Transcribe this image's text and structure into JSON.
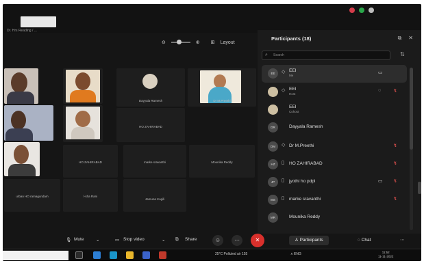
{
  "meeting": {
    "layout_label": "Layout",
    "top_strip_text": "Dr. Hrs Reading / ..."
  },
  "panel": {
    "title": "Participants (18)",
    "search_placeholder": "Search",
    "participants": [
      {
        "initials": "EE",
        "name": "EEI",
        "sub": "Me",
        "selected": true
      },
      {
        "initials": "",
        "name": "EEI",
        "sub": "Host",
        "selected": false
      },
      {
        "initials": "",
        "name": "EEI",
        "sub": "Cohost",
        "selected": false
      },
      {
        "initials": "DR",
        "name": "Dayyala Ramesh",
        "sub": "",
        "selected": false
      },
      {
        "initials": "DM",
        "name": "Dr M.Preethi",
        "sub": "",
        "selected": false
      },
      {
        "initials": "HZ",
        "name": "HO ZAHIRABAD",
        "sub": "",
        "selected": false
      },
      {
        "initials": "JP",
        "name": "jyothi ho pdpl",
        "sub": "",
        "selected": false
      },
      {
        "initials": "MS",
        "name": "marke sravanthi",
        "sub": "",
        "selected": false
      },
      {
        "initials": "MR",
        "name": "Mounika Reddy",
        "sub": "",
        "selected": false
      }
    ]
  },
  "tiles": {
    "dayyala": "Dayyala Ramesh",
    "preethi": "Dr M.Preethi",
    "zahirabad": "HO ZAHIRABAD",
    "marke": "marke sravanthi",
    "mounika": "Mounika Reddy",
    "ramagundam": "urban HO ramagundam",
    "lucky": "l-sha Rani",
    "jamuna": "Jamuna Kogili"
  },
  "toolbar": {
    "mute": "Mute",
    "stop_video": "Stop video",
    "share": "Share",
    "participants": "Participants",
    "chat": "Chat"
  },
  "taskbar": {
    "weather": "25°C  Polluted air 155",
    "tray": "∧  ENG",
    "time": "11:52",
    "date": "11-11-2022"
  },
  "colors": {
    "accent": "#2e6fd6",
    "leave": "#d9302c",
    "mic_off": "#e0514e"
  }
}
